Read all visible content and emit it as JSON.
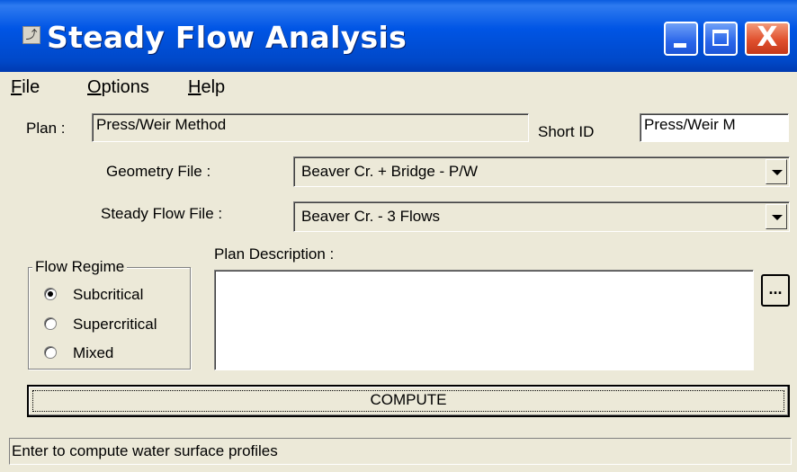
{
  "window": {
    "title": "Steady Flow Analysis",
    "close_glyph": "X"
  },
  "menu": [
    {
      "label": "File"
    },
    {
      "label": "Options"
    },
    {
      "label": "Help"
    }
  ],
  "plan": {
    "label": "Plan :",
    "value": "Press/Weir Method",
    "short_id_label": "Short ID",
    "short_id_value": "Press/Weir M"
  },
  "geometry": {
    "label": "Geometry File :",
    "value": "Beaver Cr. + Bridge - P/W"
  },
  "steady_flow": {
    "label": "Steady Flow File :",
    "value": "Beaver Cr. - 3 Flows"
  },
  "flow_regime": {
    "title": "Flow Regime",
    "options": [
      {
        "label": "Subcritical",
        "checked": true
      },
      {
        "label": "Supercritical",
        "checked": false
      },
      {
        "label": "Mixed",
        "checked": false
      }
    ]
  },
  "plan_description": {
    "label": "Plan Description :",
    "value": "",
    "browse_label": "..."
  },
  "compute_button": "COMPUTE",
  "status": "Enter to compute water surface profiles"
}
